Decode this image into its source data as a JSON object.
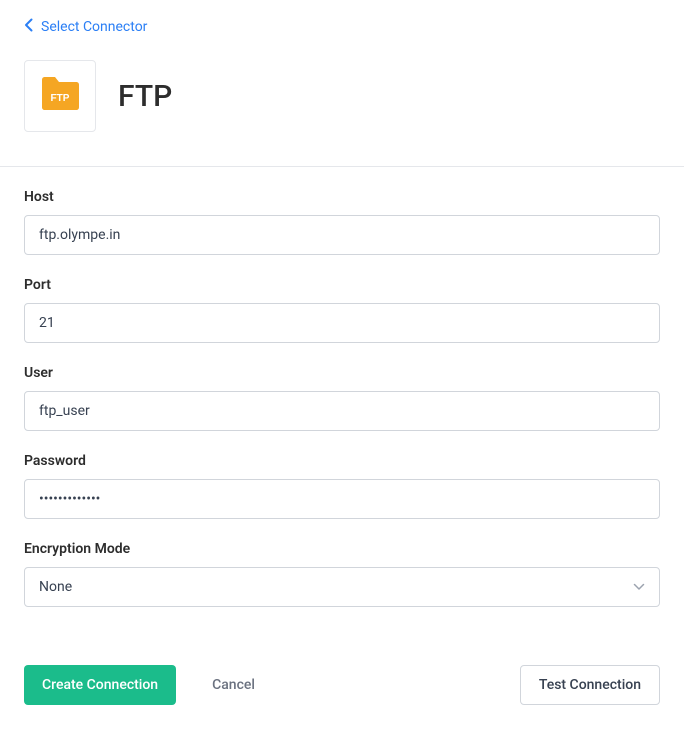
{
  "nav": {
    "back_label": "Select Connector"
  },
  "header": {
    "title": "FTP",
    "icon_label": "FTP"
  },
  "form": {
    "host": {
      "label": "Host",
      "value": "ftp.olympe.in"
    },
    "port": {
      "label": "Port",
      "value": "21"
    },
    "user": {
      "label": "User",
      "value": "ftp_user"
    },
    "password": {
      "label": "Password",
      "value": "•••••••••••••"
    },
    "encryption": {
      "label": "Encryption Mode",
      "value": "None"
    }
  },
  "buttons": {
    "create": "Create Connection",
    "cancel": "Cancel",
    "test": "Test Connection"
  }
}
